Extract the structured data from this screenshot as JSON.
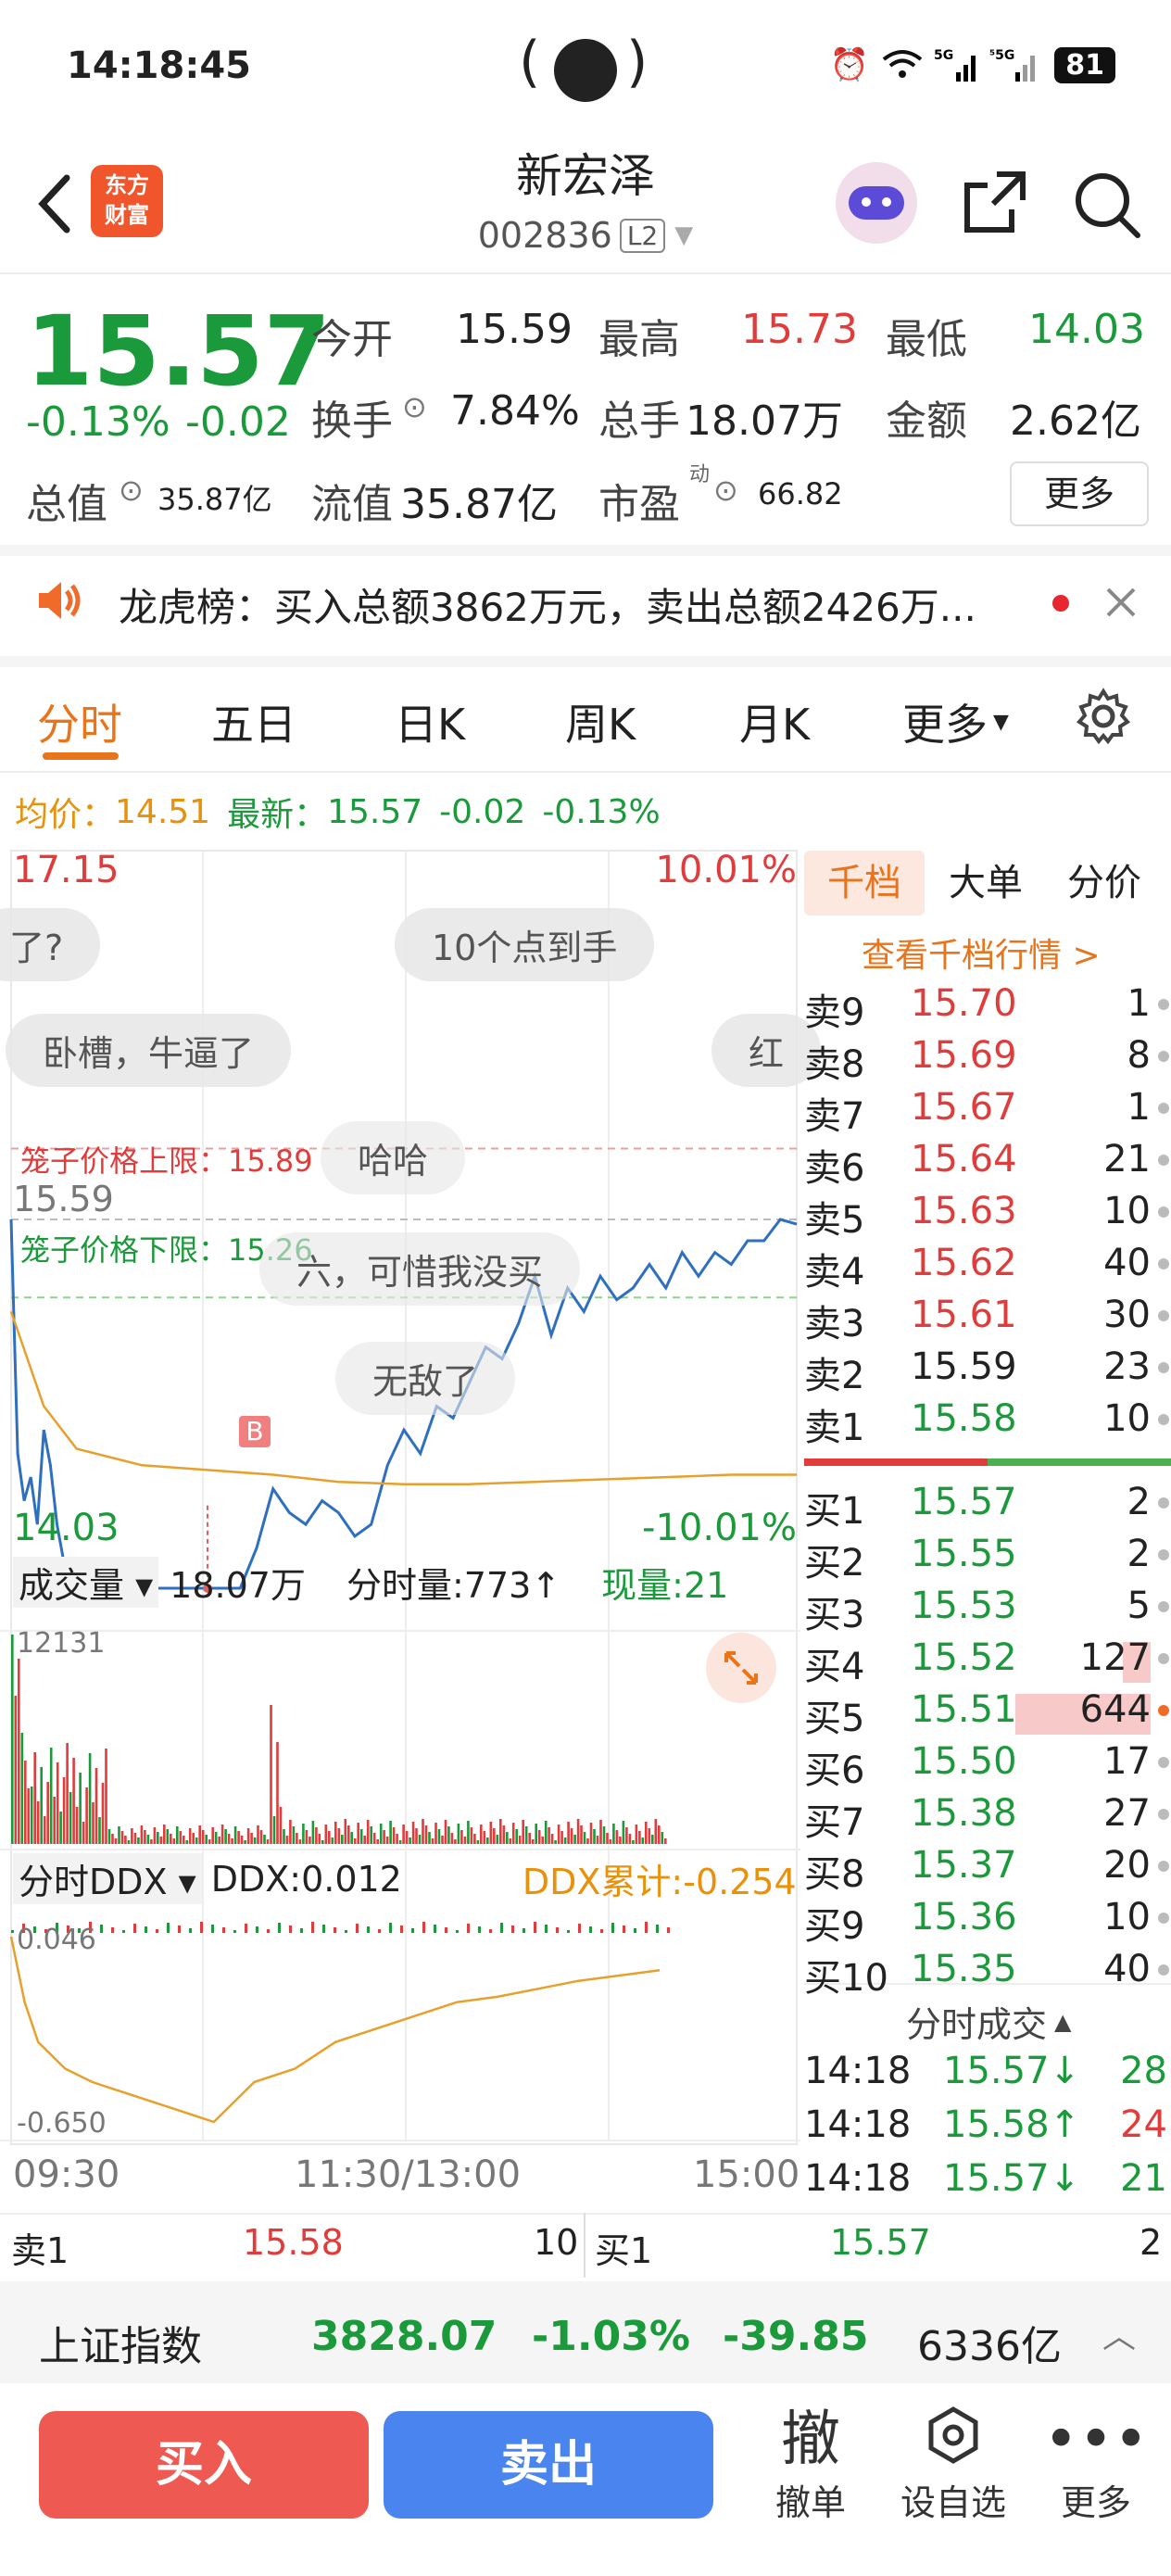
{
  "status": {
    "time": "14:18:45",
    "battery": "81",
    "icons": [
      "alarm-icon",
      "wifi-icon",
      "signal-5g-icon",
      "signal-5g-2-icon"
    ]
  },
  "header": {
    "stock_name": "新宏泽",
    "stock_code": "002836",
    "level_badge": "L2",
    "logo_text_1": "东方",
    "logo_text_2": "财富"
  },
  "quote": {
    "price": "15.57",
    "change_pct": "-0.13%",
    "change_abs": "-0.02",
    "open_label": "今开",
    "open": "15.59",
    "high_label": "最高",
    "high": "15.73",
    "low_label": "最低",
    "low": "14.03",
    "turnover_label": "换手",
    "turnover": "7.84%",
    "volume_label": "总手",
    "volume": "18.07万",
    "amount_label": "金额",
    "amount": "2.62亿",
    "mktcap_label": "总值",
    "mktcap": "35.87亿",
    "float_label": "流值",
    "float_cap": "35.87亿",
    "pe_label": "市盈",
    "pe_sup": "动",
    "pe": "66.82",
    "more_label": "更多"
  },
  "notice": {
    "text": "龙虎榜：买入总额3862万元，卖出总额2426万..."
  },
  "tabs": [
    "分时",
    "五日",
    "日K",
    "周K",
    "月K",
    "更多"
  ],
  "avg_bar": {
    "avg_label": "均价：",
    "avg": "14.51",
    "latest_label": "最新：",
    "latest": "15.57",
    "chg": "-0.02",
    "pct": "-0.13%"
  },
  "chart_labels": {
    "top_price": "17.15",
    "top_pct": "10.01%",
    "bottom_price": "14.03",
    "bottom_pct": "-10.01%",
    "ref_price": "15.59",
    "cage_upper": "笼子价格上限：15.89",
    "cage_lower": "笼子价格下限：15.26",
    "marker": "B",
    "vol_label": "成交量",
    "vol_total": "18.07万",
    "tick_vol": "分时量:773↑",
    "now_vol": "现量:21",
    "vol_max": "12131",
    "ddx_label": "分时DDX",
    "ddx": "DDX:0.012",
    "ddx_cum": "DDX累计:-0.254",
    "ddx_top": "0.046",
    "ddx_bottom": "-0.650",
    "time_start": "09:30",
    "time_mid": "11:30/13:00",
    "time_end": "15:00"
  },
  "bubbles": [
    "了?",
    "10个点到手",
    "卧槽，牛逼了",
    "红",
    "哈哈",
    "六，可惜我没买",
    "无敌了"
  ],
  "chart_data": {
    "type": "line",
    "title": "",
    "x_range": [
      "09:30",
      "15:00"
    ],
    "ylim": [
      14.03,
      17.15
    ],
    "series": [
      {
        "x": [
          0,
          2,
          4,
          6,
          8,
          10,
          12,
          14,
          16,
          18,
          20,
          25,
          30,
          40,
          50,
          60,
          70,
          75,
          80,
          85,
          90,
          95,
          100,
          105,
          110,
          115,
          120,
          125,
          130,
          135,
          140,
          145,
          150,
          155,
          160,
          165,
          170,
          175,
          180,
          185,
          190,
          195,
          200,
          205,
          210,
          215,
          220,
          225,
          230,
          235,
          240
        ],
        "values": [
          15.59,
          14.6,
          14.4,
          14.5,
          14.3,
          14.7,
          14.55,
          14.3,
          14.15,
          14.1,
          14.05,
          14.03,
          14.03,
          14.03,
          14.03,
          14.03,
          14.03,
          14.2,
          14.45,
          14.35,
          14.3,
          14.4,
          14.35,
          14.25,
          14.3,
          14.55,
          14.7,
          14.6,
          14.8,
          14.75,
          14.9,
          15.05,
          15.0,
          15.15,
          15.35,
          15.1,
          15.3,
          15.2,
          15.35,
          15.25,
          15.3,
          15.4,
          15.3,
          15.45,
          15.35,
          15.45,
          15.4,
          15.5,
          15.5,
          15.59,
          15.57
        ]
      },
      {
        "x": [
          0,
          10,
          20,
          40,
          60,
          80,
          100,
          120,
          140,
          160,
          180,
          200,
          220,
          240
        ],
        "values": [
          15.2,
          14.8,
          14.62,
          14.55,
          14.53,
          14.51,
          14.48,
          14.47,
          14.47,
          14.48,
          14.49,
          14.5,
          14.51,
          14.51
        ]
      }
    ],
    "cage_upper": 15.89,
    "cage_lower": 15.26,
    "ddx": {
      "x": [
        0,
        5,
        10,
        20,
        30,
        45,
        60,
        75,
        90,
        105,
        120,
        135,
        150,
        165,
        180,
        195,
        210,
        225,
        240
      ],
      "values": [
        0.046,
        -0.2,
        -0.35,
        -0.45,
        -0.5,
        -0.55,
        -0.6,
        -0.65,
        -0.5,
        -0.45,
        -0.35,
        -0.3,
        -0.25,
        -0.2,
        -0.18,
        -0.15,
        -0.12,
        -0.1,
        -0.08
      ]
    }
  },
  "orderbook": {
    "tabs": [
      "千档",
      "大单",
      "分价"
    ],
    "link": "查看千档行情 >",
    "asks": [
      {
        "label": "卖9",
        "price": "15.70",
        "qty": "1"
      },
      {
        "label": "卖8",
        "price": "15.69",
        "qty": "8"
      },
      {
        "label": "卖7",
        "price": "15.67",
        "qty": "1"
      },
      {
        "label": "卖6",
        "price": "15.64",
        "qty": "21"
      },
      {
        "label": "卖5",
        "price": "15.63",
        "qty": "10"
      },
      {
        "label": "卖4",
        "price": "15.62",
        "qty": "40"
      },
      {
        "label": "卖3",
        "price": "15.61",
        "qty": "30"
      },
      {
        "label": "卖2",
        "price": "15.59",
        "qty": "23"
      },
      {
        "label": "卖1",
        "price": "15.58",
        "qty": "10"
      }
    ],
    "bids": [
      {
        "label": "买1",
        "price": "15.57",
        "qty": "2"
      },
      {
        "label": "买2",
        "price": "15.55",
        "qty": "2"
      },
      {
        "label": "买3",
        "price": "15.53",
        "qty": "5"
      },
      {
        "label": "买4",
        "price": "15.52",
        "qty": "127"
      },
      {
        "label": "买5",
        "price": "15.51",
        "qty": "644"
      },
      {
        "label": "买6",
        "price": "15.50",
        "qty": "17"
      },
      {
        "label": "买7",
        "price": "15.38",
        "qty": "27"
      },
      {
        "label": "买8",
        "price": "15.37",
        "qty": "20"
      },
      {
        "label": "买9",
        "price": "15.36",
        "qty": "10"
      },
      {
        "label": "买10",
        "price": "15.35",
        "qty": "40"
      }
    ],
    "ticks_label": "分时成交",
    "ticks": [
      {
        "time": "14:18",
        "price": "15.57↓",
        "qty": "28"
      },
      {
        "time": "14:18",
        "price": "15.58↑",
        "qty": "24"
      },
      {
        "time": "14:18",
        "price": "15.57↓",
        "qty": "21"
      }
    ]
  },
  "bottom_ticker": {
    "sell_label": "卖1",
    "sell_price": "15.58",
    "sell_qty": "10",
    "buy_label": "买1",
    "buy_price": "15.57",
    "buy_qty": "2"
  },
  "index": {
    "name": "上证指数",
    "value": "3828.07",
    "pct": "-1.03%",
    "chg": "-39.85",
    "amount": "6336亿"
  },
  "actions": {
    "buy": "买入",
    "sell": "卖出",
    "cancel_icon": "撤",
    "cancel": "撤单",
    "watch": "设自选",
    "more": "更多"
  }
}
